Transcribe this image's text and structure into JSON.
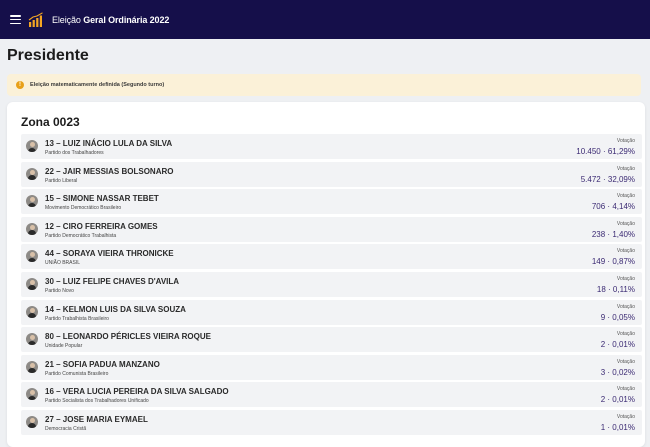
{
  "header": {
    "title_prefix": "Eleição ",
    "title_bold": "Geral Ordinária 2022"
  },
  "page": {
    "title": "Presidente",
    "alert": "Eleição matematicamente definida (Segundo turno)"
  },
  "zone": {
    "title": "Zona 0023",
    "vote_label": "Votação",
    "candidates": [
      {
        "name": "13 – LUIZ INÁCIO LULA DA SILVA",
        "party": "Partido dos Trabalhadores",
        "votes": "10.450 · 61,29%"
      },
      {
        "name": "22 – JAIR MESSIAS BOLSONARO",
        "party": "Partido Liberal",
        "votes": "5.472 · 32,09%"
      },
      {
        "name": "15 – SIMONE NASSAR TEBET",
        "party": "Movimento Democrático Brasileiro",
        "votes": "706 · 4,14%"
      },
      {
        "name": "12 – CIRO FERREIRA GOMES",
        "party": "Partido Democrático Trabalhista",
        "votes": "238 · 1,40%"
      },
      {
        "name": "44 – SORAYA VIEIRA THRONICKE",
        "party": "UNIÃO BRASIL",
        "votes": "149 · 0,87%"
      },
      {
        "name": "30 – LUIZ FELIPE CHAVES D'AVILA",
        "party": "Partido Novo",
        "votes": "18 · 0,11%"
      },
      {
        "name": "14 – KELMON LUIS DA SILVA SOUZA",
        "party": "Partido Trabalhista Brasileiro",
        "votes": "9 · 0,05%"
      },
      {
        "name": "80 – LEONARDO PÉRICLES VIEIRA ROQUE",
        "party": "Unidade Popular",
        "votes": "2 · 0,01%"
      },
      {
        "name": "21 – SOFIA PADUA MANZANO",
        "party": "Partido Comunista Brasileiro",
        "votes": "3 · 0,02%"
      },
      {
        "name": "16 – VERA LUCIA PEREIRA DA SILVA SALGADO",
        "party": "Partido Socialista dos Trabalhadores Unificado",
        "votes": "2 · 0,01%"
      },
      {
        "name": "27 – JOSE MARIA EYMAEL",
        "party": "Democracia Cristã",
        "votes": "1 · 0,01%"
      }
    ]
  }
}
